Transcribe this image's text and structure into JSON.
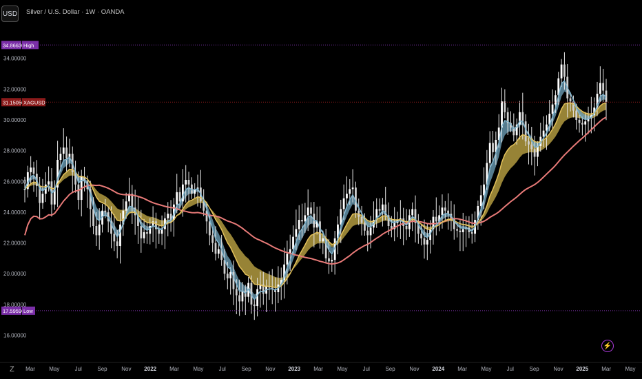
{
  "header": {
    "currency_button": "USD",
    "title": "Silver / U.S. Dollar · 1W · OANDA"
  },
  "chart_data": {
    "type": "line",
    "ylim": [
      14.5,
      36.0
    ],
    "y_ticks": [
      "16.00000",
      "18.00000",
      "20.00000",
      "22.00000",
      "24.00000",
      "26.00000",
      "28.00000",
      "30.00000",
      "32.00000",
      "34.00000"
    ],
    "x_ticks": [
      "Mar",
      "May",
      "Jul",
      "Sep",
      "Nov",
      "2022",
      "Mar",
      "May",
      "Jul",
      "Sep",
      "Nov",
      "2023",
      "Mar",
      "May",
      "Jul",
      "Sep",
      "Nov",
      "2024",
      "Mar",
      "May",
      "Jul",
      "Sep",
      "Nov",
      "2025",
      "Mar",
      "May"
    ],
    "price_markers": [
      {
        "value": "34.86630",
        "label": "High",
        "color": "#7b2fa8"
      },
      {
        "value": "31.15050",
        "label": "XAGUSD",
        "color": "#8b1a1a"
      },
      {
        "value": "17.59590",
        "label": "Low",
        "color": "#7b2fa8"
      }
    ],
    "price_weekly": [
      25.5,
      26.6,
      26.9,
      26.5,
      25.7,
      24.6,
      25.2,
      25.8,
      26.0,
      24.5,
      25.6,
      27.4,
      27.8,
      28.2,
      27.5,
      27.8,
      26.6,
      25.8,
      24.8,
      26.3,
      26.0,
      25.5,
      24.2,
      23.1,
      22.5,
      23.2,
      24.1,
      24.0,
      23.4,
      22.6,
      22.1,
      21.8,
      23.2,
      24.1,
      24.7,
      25.2,
      24.3,
      23.8,
      23.1,
      22.3,
      22.7,
      22.6,
      23.1,
      23.4,
      22.9,
      22.6,
      22.9,
      23.6,
      23.9,
      23.5,
      24.5,
      25.3,
      24.7,
      25.8,
      26.1,
      25.8,
      25.2,
      25.5,
      25.6,
      24.7,
      24.1,
      23.4,
      22.5,
      22.0,
      21.3,
      21.6,
      20.9,
      20.0,
      19.7,
      20.1,
      19.0,
      18.6,
      18.2,
      18.9,
      18.5,
      19.4,
      18.0,
      17.9,
      19.0,
      19.3,
      18.7,
      19.2,
      19.1,
      19.0,
      18.8,
      19.3,
      19.6,
      20.6,
      21.3,
      21.6,
      22.4,
      22.9,
      23.5,
      23.4,
      23.8,
      24.3,
      23.9,
      23.0,
      23.4,
      22.1,
      22.3,
      21.0,
      20.8,
      20.9,
      22.3,
      23.2,
      24.2,
      24.9,
      25.2,
      25.5,
      25.6,
      24.1,
      23.7,
      23.3,
      22.8,
      22.5,
      23.0,
      23.5,
      24.2,
      24.1,
      24.5,
      23.8,
      23.1,
      22.9,
      23.3,
      23.5,
      23.6,
      23.1,
      22.9,
      23.8,
      24.2,
      23.3,
      22.6,
      22.3,
      21.9,
      22.2,
      22.9,
      23.7,
      23.4,
      23.8,
      24.3,
      24.1,
      23.9,
      23.6,
      22.9,
      22.8,
      22.7,
      22.9,
      23.0,
      22.7,
      22.6,
      23.5,
      24.4,
      25.1,
      25.8,
      27.2,
      28.5,
      27.9,
      28.7,
      29.5,
      31.2,
      30.5,
      29.8,
      29.5,
      29.0,
      29.7,
      30.5,
      29.9,
      28.6,
      28.4,
      28.1,
      27.6,
      28.3,
      28.9,
      29.3,
      29.7,
      30.4,
      31.0,
      31.6,
      32.7,
      33.6,
      32.8,
      31.4,
      31.2,
      30.6,
      30.0,
      29.8,
      29.7,
      29.9,
      30.1,
      30.3,
      30.8,
      31.7,
      32.4,
      31.9,
      31.15
    ],
    "series": [
      {
        "name": "",
        "color": "#7fb3cc"
      },
      {
        "name": "",
        "color": "#e4c25c"
      },
      {
        "name": "",
        "color": "#e87a78"
      }
    ],
    "grid": false
  }
}
